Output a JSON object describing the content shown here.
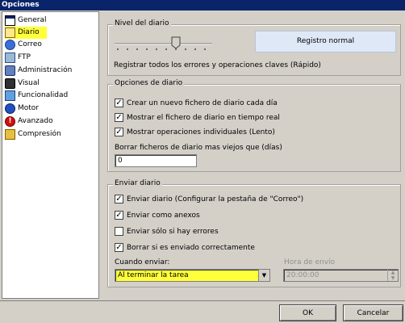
{
  "window": {
    "title": "Opciones"
  },
  "sidebar": {
    "items": [
      {
        "label": "General"
      },
      {
        "label": "Diario"
      },
      {
        "label": "Correo"
      },
      {
        "label": "FTP"
      },
      {
        "label": "Administración"
      },
      {
        "label": "Visual"
      },
      {
        "label": "Funcionalidad"
      },
      {
        "label": "Motor"
      },
      {
        "label": "Avanzado"
      },
      {
        "label": "Compresión"
      }
    ]
  },
  "nivel": {
    "legend": "Nivel del diario",
    "level_box": "Registro normal",
    "description": "Registrar todos los errores y operaciones claves (Rápido)"
  },
  "opciones": {
    "legend": "Opciones de diario",
    "checks": [
      {
        "label": "Crear un nuevo fichero de diario cada día",
        "checked": true
      },
      {
        "label": "Mostrar el fichero de diario en tiempo real",
        "checked": true
      },
      {
        "label": "Mostrar operaciones individuales (Lento)",
        "checked": true
      }
    ],
    "delete_label": "Borrar ficheros de diario mas viejos que (días)",
    "delete_value": "0"
  },
  "enviar": {
    "legend": "Enviar diario",
    "checks": [
      {
        "label": "Enviar diario (Configurar la pestaña de \"Correo\")",
        "checked": true
      },
      {
        "label": "Enviar como anexos",
        "checked": true
      },
      {
        "label": "Enviar sólo si hay errores",
        "checked": false
      },
      {
        "label": "Borrar si es enviado correctamente",
        "checked": true
      }
    ],
    "when_label": "Cuando enviar:",
    "when_value": "Al terminar la tarea",
    "time_label": "Hora de envío",
    "time_value": "20:00:00"
  },
  "buttons": {
    "ok": "OK",
    "cancel": "Cancelar"
  },
  "check_glyph": "✓"
}
